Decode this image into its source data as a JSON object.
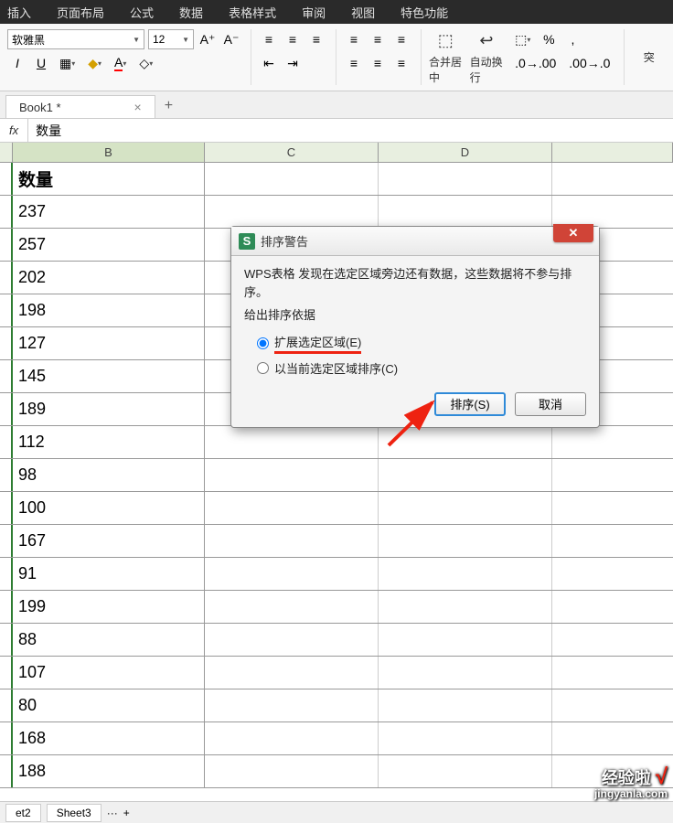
{
  "menus": [
    "插入",
    "页面布局",
    "公式",
    "数据",
    "表格样式",
    "审阅",
    "视图",
    "特色功能"
  ],
  "font": {
    "name": "软雅黑",
    "size": "12"
  },
  "tabs": {
    "doc": "Book1 *",
    "add": "+"
  },
  "formula": {
    "fx": "fx",
    "value": "数量"
  },
  "cols": {
    "B": "B",
    "C": "C",
    "D": "D"
  },
  "header": "数量",
  "values": [
    "237",
    "257",
    "202",
    "198",
    "127",
    "145",
    "189",
    "112",
    "98",
    "100",
    "167",
    "91",
    "199",
    "88",
    "107",
    "80",
    "168",
    "188"
  ],
  "merge": "合并居中",
  "wrap": "自动换行",
  "overflow": "突",
  "sheets": {
    "s2": "et2",
    "s3": "Sheet3",
    "more": "···",
    "add": "+"
  },
  "dialog": {
    "title": "排序警告",
    "msg": "WPS表格 发现在选定区域旁边还有数据，这些数据将不参与排序。",
    "label": "给出排序依据",
    "opt1": "扩展选定区域(E)",
    "opt2": "以当前选定区域排序(C)",
    "ok": "排序(S)",
    "cancel": "取消"
  },
  "watermark": {
    "main": "经验啦",
    "check": "√",
    "sub": "jingyanla.com"
  },
  "icons": {
    "percent": "%",
    "comma": ",",
    "dec_inc": ".0",
    "dec_dec": ".00"
  }
}
